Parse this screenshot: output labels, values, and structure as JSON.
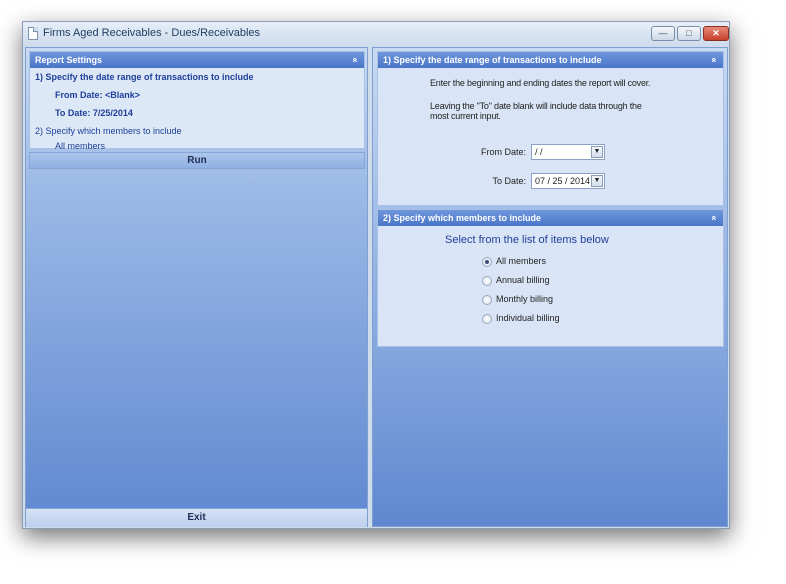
{
  "window": {
    "title": "Firms Aged Receivables - Dues/Receivables",
    "minimize_glyph": "—",
    "maximize_glyph": "□",
    "close_glyph": "✕"
  },
  "report_settings": {
    "title": "Report Settings",
    "collapse_glyph": "«",
    "step1": "1)  Specify the date range of transactions to include",
    "from_date": "From Date:  <Blank>",
    "to_date": "To Date:  7/25/2014",
    "step2": "2)  Specify which members to include",
    "members_value": "All members"
  },
  "run_label": "Run",
  "exit_label": "Exit",
  "date_section": {
    "title": "1)  Specify the date range of transactions to include",
    "collapse_glyph": "«",
    "instructions1": "Enter the beginning and ending dates the report will cover.",
    "instructions2a": "Leaving the \"To\" date blank will include data through the",
    "instructions2b": "most current input.",
    "from_label": "From Date:",
    "from_value": "   /    /",
    "to_label": "To Date:",
    "to_value": "07 / 25 / 2014",
    "dropdown_glyph": "▼"
  },
  "members_section": {
    "title": "2)  Specify which members to include",
    "collapse_glyph": "«",
    "heading": "Select from the list of items below",
    "options": [
      {
        "label": "All members",
        "checked": true
      },
      {
        "label": "Annual billing",
        "checked": false
      },
      {
        "label": "Monthly billing",
        "checked": false
      },
      {
        "label": "Individual billing",
        "checked": false
      }
    ]
  },
  "icons": {
    "window": "document-icon",
    "collapse": "double-chevron-up-icon",
    "dropdown": "chevron-down-icon"
  }
}
